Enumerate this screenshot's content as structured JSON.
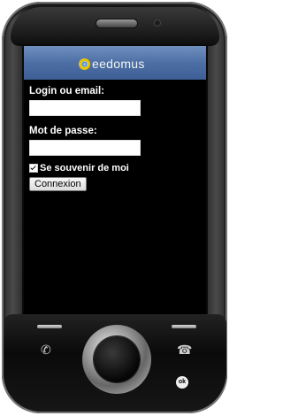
{
  "app": {
    "logo_text": "eedomus"
  },
  "login": {
    "login_label": "Login ou email:",
    "password_label": "Mot de passe:",
    "login_value": "",
    "password_value": "",
    "remember_label": "Se souvenir de moi",
    "remember_checked": true,
    "submit_label": "Connexion"
  },
  "device": {
    "ok_label": "ok",
    "call_icon": "call-icon",
    "end_call_icon": "end-call-icon"
  }
}
